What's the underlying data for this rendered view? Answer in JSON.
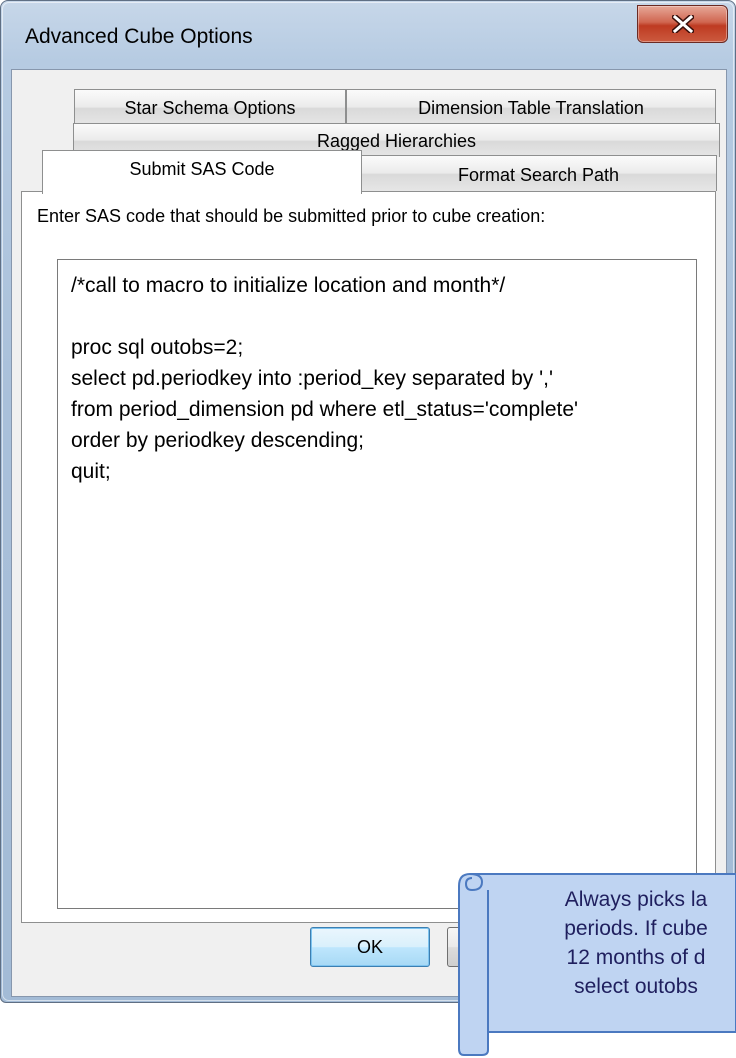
{
  "window": {
    "title": "Advanced Cube Options"
  },
  "tabs": {
    "star_schema": "Star Schema Options",
    "dimension_translation": "Dimension Table Translation",
    "ragged": "Ragged Hierarchies",
    "submit_sas": "Submit SAS Code",
    "format_search": "Format Search Path",
    "active": "Submit SAS Code"
  },
  "panel": {
    "prompt": "Enter SAS code that should be submitted prior to cube creation:",
    "code_lines": [
      "/*call to macro to initialize location and month*/",
      "",
      "proc sql outobs=2;",
      "select pd.periodkey into :period_key separated by ','",
      "from period_dimension pd where etl_status='complete'",
      "order by periodkey descending;",
      "quit;"
    ]
  },
  "buttons": {
    "ok": "OK",
    "cancel": ""
  },
  "callout": {
    "text": "Always picks la\nperiods. If cube\n12 months of d\nselect outobs"
  },
  "colors": {
    "title_bar": "#b6cbe2",
    "close_button": "#c8472c",
    "callout_fill": "#bfd4f2",
    "callout_border": "#4b79c0",
    "callout_text": "#1f1f5e"
  }
}
